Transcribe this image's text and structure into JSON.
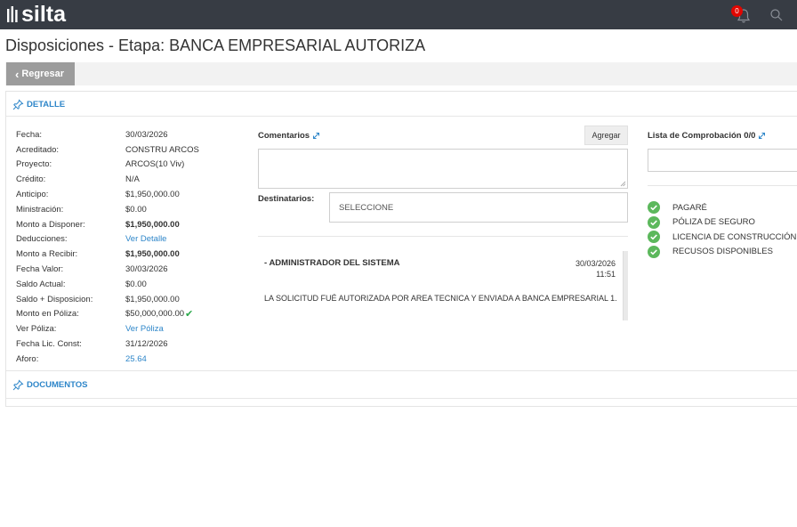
{
  "app": {
    "logo_text": "silta",
    "notification_count": "0"
  },
  "page": {
    "title": "Disposiciones - Etapa: BANCA EMPRESARIAL AUTORIZA"
  },
  "toolbar": {
    "back_label": "Regresar"
  },
  "detail": {
    "section_title": "DETALLE",
    "rows": [
      {
        "label": "Fecha:",
        "value": "30/03/2026"
      },
      {
        "label": "Acreditado:",
        "value": "CONSTRU ARCOS"
      },
      {
        "label": "Proyecto:",
        "value": "ARCOS(10 Viv)"
      },
      {
        "label": "Crédito:",
        "value": "N/A"
      },
      {
        "label": "Anticipo:",
        "value": "$1,950,000.00"
      },
      {
        "label": "Ministración:",
        "value": "$0.00"
      },
      {
        "label": "Monto a Disponer:",
        "value": "$1,950,000.00"
      },
      {
        "label": "Deducciones:",
        "value": "Ver Detalle"
      },
      {
        "label": "Monto a Recibir:",
        "value": "$1,950,000.00"
      },
      {
        "label": "Fecha Valor:",
        "value": "30/03/2026"
      },
      {
        "label": "Saldo Actual:",
        "value": "$0.00"
      },
      {
        "label": "Saldo + Disposicion:",
        "value": "$1,950,000.00"
      },
      {
        "label": "Monto en Póliza:",
        "value": "$50,000,000.00"
      },
      {
        "label": "Ver Póliza:",
        "value": "Ver Póliza"
      },
      {
        "label": "Fecha Lic. Const:",
        "value": "31/12/2026"
      },
      {
        "label": "Aforo:",
        "value": "25.64"
      }
    ]
  },
  "comments": {
    "title": "Comentarios",
    "add_label": "Agregar",
    "text_value": "",
    "recipients_label": "Destinatarios:",
    "recipients_value": "SELECCIONE",
    "messages": [
      {
        "author": "- ADMINISTRADOR DEL SISTEMA",
        "date": "30/03/2026",
        "time": "11:51",
        "text": "LA SOLICITUD FUÉ AUTORIZADA POR AREA TECNICA Y ENVIADA A BANCA EMPRESARIAL 1."
      }
    ]
  },
  "checklist": {
    "title": "Lista de Comprobación 0/0",
    "items": [
      {
        "label": "PAGARÉ"
      },
      {
        "label": "PÓLIZA DE SEGURO"
      },
      {
        "label": "LICENCIA DE CONSTRUCCIÓN"
      },
      {
        "label": "RECUSOS DISPONIBLES"
      }
    ]
  },
  "documents": {
    "section_title": "DOCUMENTOS"
  },
  "colors": {
    "topbar": "#373c44",
    "accent_link": "#2e86c9",
    "check_green": "#2aa84a",
    "badge_red": "#e10600",
    "back_button": "#9c9c9c"
  },
  "icons": [
    "logo-mark-icon",
    "bell-icon",
    "search-icon",
    "pin-icon",
    "expand-icon",
    "check-circle-icon",
    "checkmark-icon",
    "chevron-left-icon",
    "resize-handle-icon"
  ]
}
